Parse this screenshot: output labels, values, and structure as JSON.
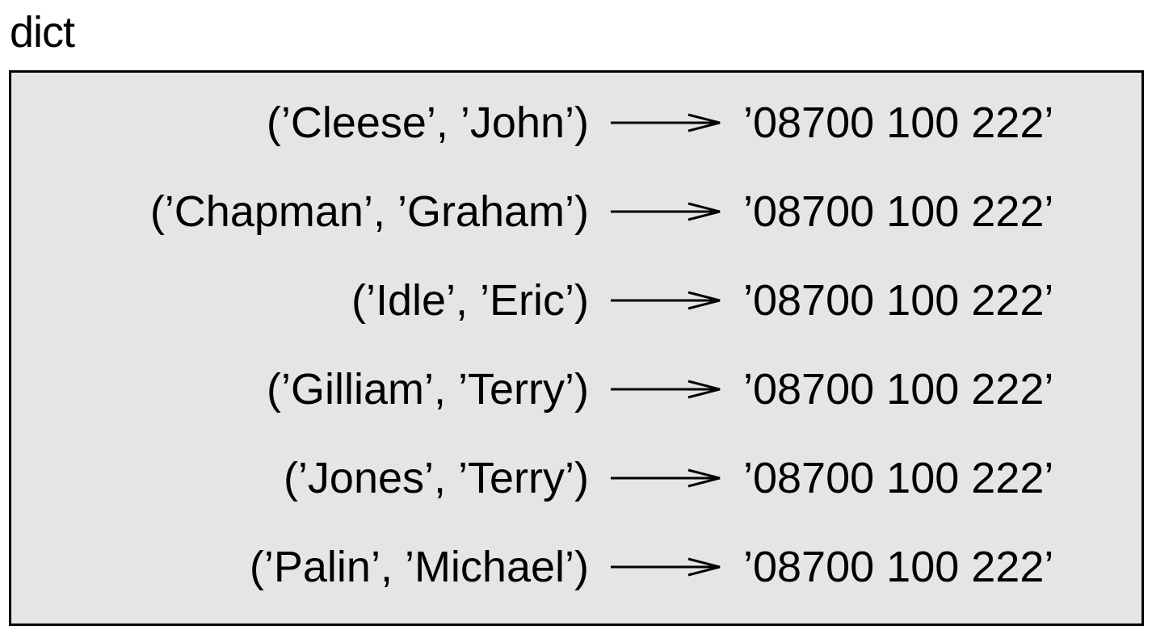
{
  "diagram": {
    "title": "dict",
    "entries": [
      {
        "key": "(’Cleese’, ’John’)",
        "value": "’08700 100 222’"
      },
      {
        "key": "(’Chapman’, ’Graham’)",
        "value": "’08700 100 222’"
      },
      {
        "key": "(’Idle’, ’Eric’)",
        "value": "’08700 100 222’"
      },
      {
        "key": "(’Gilliam’, ’Terry’)",
        "value": "’08700 100 222’"
      },
      {
        "key": "(’Jones’, ’Terry’)",
        "value": "’08700 100 222’"
      },
      {
        "key": "(’Palin’, ’Michael’)",
        "value": "’08700 100 222’"
      }
    ],
    "colors": {
      "frame_fill": "#e5e5e5",
      "frame_border": "#000000",
      "text": "#000000"
    },
    "icons": {
      "mapping_arrow": "right-arrow-icon"
    }
  }
}
